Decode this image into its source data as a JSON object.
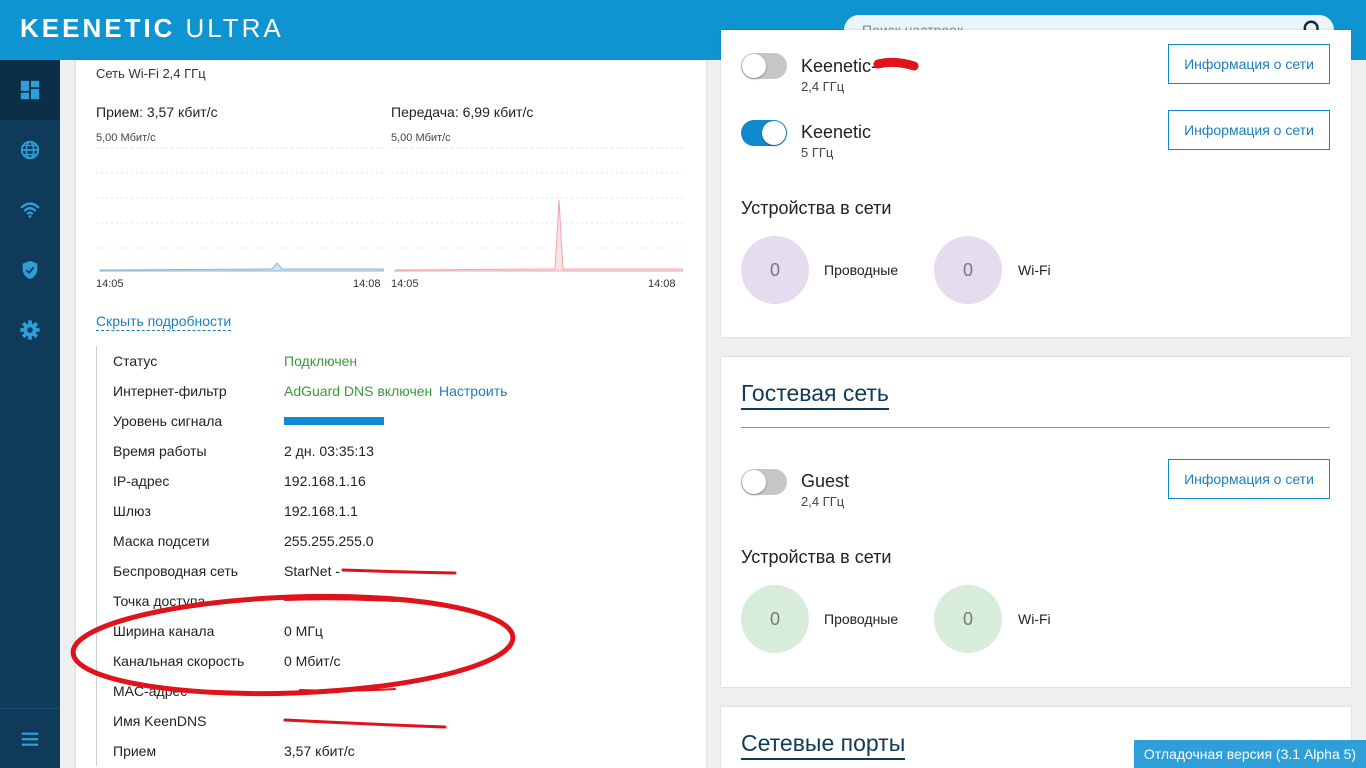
{
  "header": {
    "brand": "KEENETIC",
    "model": "ULTRA",
    "search_placeholder": "Поиск настроек"
  },
  "sidebar": {
    "items": [
      {
        "icon": "dashboard-icon",
        "active": true
      },
      {
        "icon": "globe-icon"
      },
      {
        "icon": "wifi-icon"
      },
      {
        "icon": "shield-icon"
      },
      {
        "icon": "gear-icon"
      }
    ],
    "bottom_icon": "menu-icon"
  },
  "wifi_stats": {
    "title": "Сеть Wi-Fi 2,4 ГГц",
    "rx_label": "Прием: 3,57 кбит/с",
    "tx_label": "Передача: 6,99 кбит/с",
    "rx_scale": "5,00 Мбит/с",
    "tx_scale": "5,00 Мбит/с",
    "rx_time_start": "14:05",
    "rx_time_end": "14:08",
    "tx_time_start": "14:05",
    "tx_time_end": "14:08",
    "hide_details_label": "Скрыть подробности"
  },
  "details": {
    "status": {
      "key": "Статус",
      "value": "Подключен"
    },
    "filter": {
      "key": "Интернет-фильтр",
      "value": "AdGuard DNS включен",
      "link": "Настроить"
    },
    "signal": {
      "key": "Уровень сигнала",
      "level": 1.0
    },
    "uptime": {
      "key": "Время работы",
      "value": "2 дн. 03:35:13"
    },
    "ip": {
      "key": "IP-адрес",
      "value": "192.168.1.16"
    },
    "gateway": {
      "key": "Шлюз",
      "value": "192.168.1.1"
    },
    "mask": {
      "key": "Маска подсети",
      "value": "255.255.255.0"
    },
    "wireless": {
      "key": "Беспроводная сеть",
      "value": "StarNet -"
    },
    "access_point": {
      "key": "Точка доступа",
      "value": ""
    },
    "channel_width": {
      "key": "Ширина канала",
      "value": "0 МГц"
    },
    "channel_speed": {
      "key": "Канальная скорость",
      "value": "0 Мбит/с"
    },
    "mac": {
      "key": "MAC-адрес",
      "value": ""
    },
    "keendns": {
      "key": "Имя KeenDNS",
      "value": ""
    },
    "rx": {
      "key": "Прием",
      "value": "3,57 кбит/с"
    }
  },
  "home_networks": {
    "net1": {
      "name": "Keenetic-",
      "band": "2,4 ГГц",
      "enabled": false,
      "button": "Информация о сети"
    },
    "net2": {
      "name": "Keenetic",
      "band": "5 ГГц",
      "enabled": true,
      "button": "Информация о сети"
    },
    "devices_title": "Устройства в сети",
    "wired_count": "0",
    "wired_label": "Проводные",
    "wifi_count": "0",
    "wifi_label": "Wi-Fi"
  },
  "guest_network": {
    "title": "Гостевая сеть",
    "net": {
      "name": "Guest",
      "band": "2,4 ГГц",
      "enabled": false,
      "button": "Информация о сети"
    },
    "devices_title": "Устройства в сети",
    "wired_count": "0",
    "wired_label": "Проводные",
    "wifi_count": "0",
    "wifi_label": "Wi-Fi"
  },
  "ports": {
    "title": "Сетевые порты"
  },
  "debug_badge": "Отладочная версия (3.1 Alpha 5)",
  "colors": {
    "header": "#0f94d2",
    "sidebar": "#0f3a59",
    "accent": "#1189d0",
    "ok": "#3a9a3a",
    "annotation": "#e0121b"
  }
}
